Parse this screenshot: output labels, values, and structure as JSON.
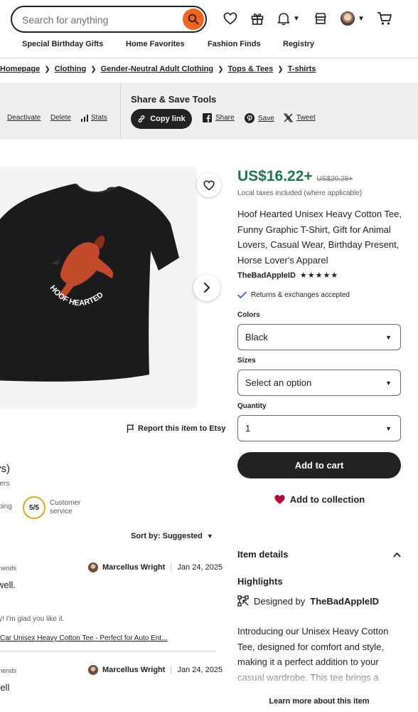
{
  "header": {
    "search_placeholder": "Search for anything",
    "icons": [
      "search-icon",
      "heart-icon",
      "gift-icon",
      "bell-icon",
      "shop-icon",
      "avatar",
      "cart-icon"
    ]
  },
  "nav": {
    "items": [
      "Special Birthday Gifts",
      "Home Favorites",
      "Fashion Finds",
      "Registry"
    ]
  },
  "breadcrumb": [
    "Homepage",
    "Clothing",
    "Gender-Neutral Adult Clothing",
    "Tops & Tees",
    "T-shirts"
  ],
  "manage": {
    "deactivate": "Deactivate",
    "delete": "Delete",
    "stats": "Stats"
  },
  "share": {
    "title": "Share & Save Tools",
    "copy_link": "Copy link",
    "facebook": "Share",
    "pinterest": "Save",
    "x": "Tweet"
  },
  "product": {
    "price": "US$16.22+",
    "original_price": "US$20.28+",
    "taxes": "Local taxes included (where applicable)",
    "title": "Hoof Hearted Unisex Heavy Cotton Tee, Funny Graphic T-Shirt, Gift for Animal Lovers, Casual Wear, Birthday Present, Horse Lover's Apparel",
    "shop_name": "TheBadAppleID",
    "stars": "★★★★★",
    "returns": "Returns & exchanges accepted",
    "shirt_text": "HOOF HEARTED",
    "colors_label": "Colors",
    "colors_value": "Black",
    "sizes_label": "Sizes",
    "sizes_value": "Select an option",
    "quantity_label": "Quantity",
    "quantity_value": "1",
    "add_to_cart": "Add to cart",
    "add_to_collection": "Add to collection",
    "report": "Report this item to Etsy"
  },
  "details": {
    "item_details": "Item details",
    "highlights": "Highlights",
    "designed_by_prefix": "Designed by",
    "designed_by_shop": "TheBadAppleID",
    "description": "Introducing our Unisex Heavy Cotton Tee, designed for comfort and style, making it a perfect addition to your casual wardrobe. This tee brings a",
    "learn_more": "Learn more about this item"
  },
  "reviews": {
    "title_partial": "vs)",
    "subtitle_partial": "rers",
    "rating_left_partial": "ping",
    "customer_service_score": "5/5",
    "customer_service_label": "Customer service",
    "sort_by": "Sort by: Suggested",
    "items": [
      {
        "meta_partial": "mends",
        "author": "Marcellus Wright",
        "date": "Jan 24, 2025",
        "text_partial": "well.",
        "reply_partial": "y! I'm glad you like it.",
        "link_partial": "Car Unisex Heavy Cotton Tee - Perfect for Auto Ent..."
      },
      {
        "meta_partial": "mends",
        "author": "Marcellus Wright",
        "date": "Jan 24, 2025",
        "text_partial": "rell"
      }
    ]
  },
  "colors": {
    "accent": "#f1641e",
    "price_green": "#1a7a45",
    "dark": "#222222",
    "heart_red": "#b3093b",
    "share_bg": "#efefef",
    "score_ring": "#e9a81b"
  }
}
